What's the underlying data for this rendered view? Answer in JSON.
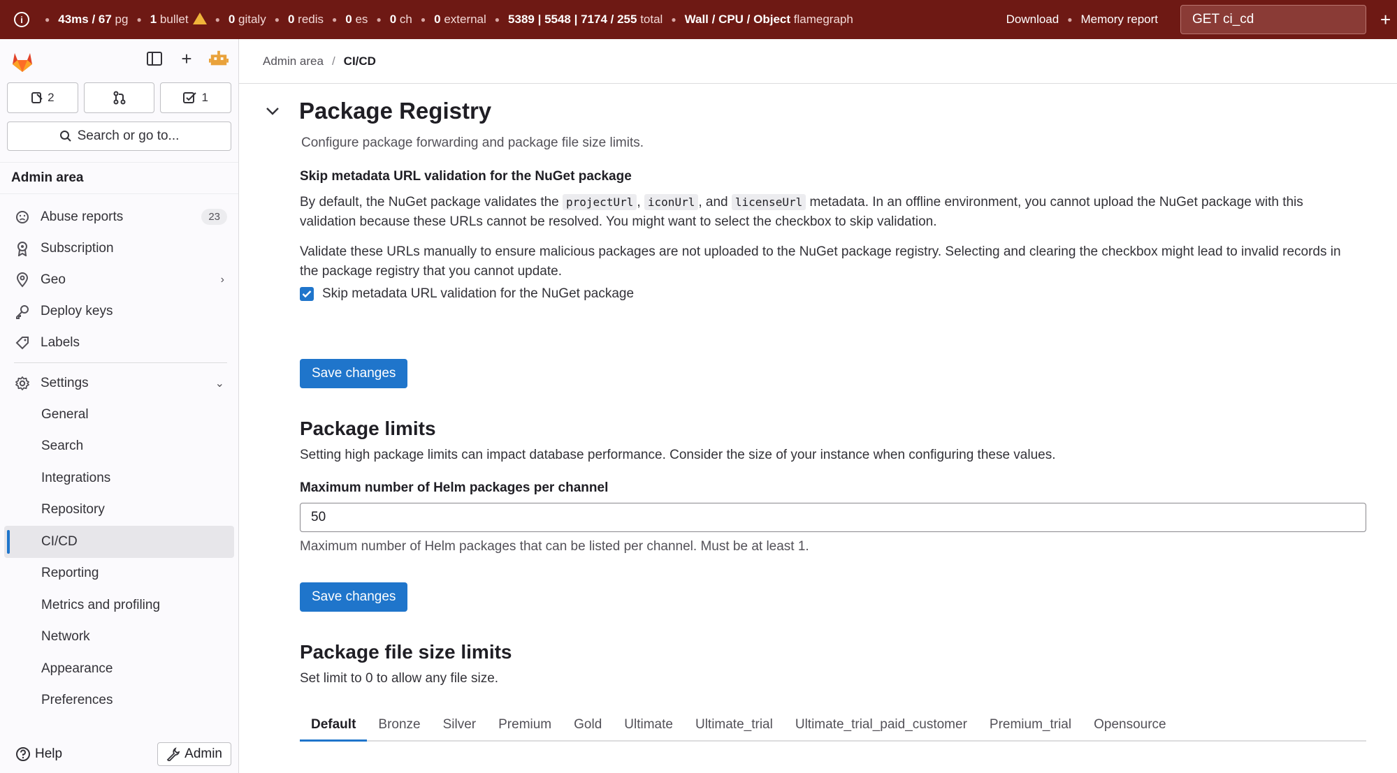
{
  "perfbar": {
    "metrics": [
      {
        "value": "43ms / 67",
        "unit": "pg"
      },
      {
        "value": "1",
        "unit": "bullet"
      },
      {
        "value": "0",
        "unit": "gitaly"
      },
      {
        "value": "0",
        "unit": "redis"
      },
      {
        "value": "0",
        "unit": "es"
      },
      {
        "value": "0",
        "unit": "ch"
      },
      {
        "value": "0",
        "unit": "external"
      },
      {
        "value": "5389 | 5548 | 7174 / 255",
        "unit": "total"
      }
    ],
    "flamegraph_modes": "Wall / CPU / Object",
    "flamegraph_label": "flamegraph",
    "download": "Download",
    "memory_report": "Memory report",
    "request": "GET ci_cd",
    "colors": {
      "bg": "#6e1914"
    }
  },
  "sidebar": {
    "counts": {
      "issues": "2",
      "todos": "1"
    },
    "search": "Search or go to...",
    "section_title": "Admin area",
    "items": [
      {
        "label": "Abuse reports",
        "badge": "23",
        "icon": "emoji-sad-icon"
      },
      {
        "label": "Subscription",
        "icon": "license-icon"
      },
      {
        "label": "Geo",
        "icon": "location-icon"
      },
      {
        "label": "Deploy keys",
        "icon": "key-icon"
      },
      {
        "label": "Labels",
        "icon": "label-icon"
      }
    ],
    "settings": {
      "label": "Settings",
      "subitems": [
        "General",
        "Search",
        "Integrations",
        "Repository",
        "CI/CD",
        "Reporting",
        "Metrics and profiling",
        "Network",
        "Appearance",
        "Preferences"
      ]
    },
    "help": "Help",
    "admin": "Admin"
  },
  "breadcrumb": {
    "root": "Admin area",
    "current": "CI/CD"
  },
  "registry": {
    "title": "Package Registry",
    "description": "Configure package forwarding and package file size limits.",
    "nuget_label": "Skip metadata URL validation for the NuGet package",
    "p1_a": "By default, the NuGet package validates the",
    "code1": "projectUrl",
    "sep": ",",
    "code2": "iconUrl",
    "and": ", and",
    "code3": "licenseUrl",
    "p1_b": "metadata. In an offline environment, you cannot upload the NuGet package with this validation because these URLs cannot be resolved. You might want to select the checkbox to skip validation.",
    "p2": "Validate these URLs manually to ensure malicious packages are not uploaded to the NuGet package registry. Selecting and clearing the checkbox might lead to invalid records in the package registry that you cannot update.",
    "checkbox_label": "Skip metadata URL validation for the NuGet package",
    "save": "Save changes"
  },
  "limits": {
    "title": "Package limits",
    "description": "Setting high package limits can impact database performance. Consider the size of your instance when configuring these values.",
    "helm_label": "Maximum number of Helm packages per channel",
    "helm_value": "50",
    "helm_help": "Maximum number of Helm packages that can be listed per channel. Must be at least 1.",
    "save": "Save changes"
  },
  "file_limits": {
    "title": "Package file size limits",
    "description": "Set limit to 0 to allow any file size.",
    "tabs": [
      "Default",
      "Bronze",
      "Silver",
      "Premium",
      "Gold",
      "Ultimate",
      "Ultimate_trial",
      "Ultimate_trial_paid_customer",
      "Premium_trial",
      "Opensource"
    ]
  }
}
